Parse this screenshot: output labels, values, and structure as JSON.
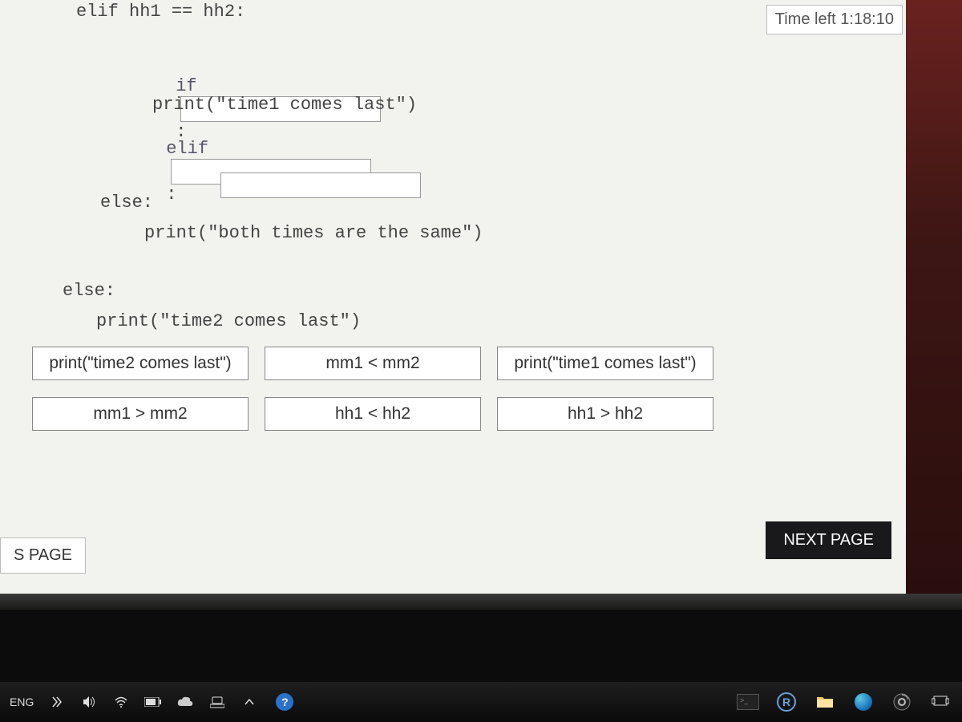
{
  "timer": {
    "label": "Time left 1:18:10"
  },
  "code": {
    "line0": "elif hh1 == hh2:",
    "if_kw": "if",
    "colon1": ":",
    "print1": "print(\"time1 comes last\")",
    "elif_kw": "elif",
    "colon2": ":",
    "inner_else": "else:",
    "print_same": "print(\"both times are the same\")",
    "outer_else": "else:",
    "print_time2": "print(\"time2 comes last\")"
  },
  "options": {
    "o1": "print(\"time2 comes last\")",
    "o2": "mm1 < mm2",
    "o3": "print(\"time1 comes last\")",
    "o4": "mm1 > mm2",
    "o5": "hh1 < hh2",
    "o6": "hh1 > hh2"
  },
  "nav": {
    "prev": "S PAGE",
    "next": "NEXT PAGE"
  },
  "taskbar": {
    "lang": "ENG",
    "help_glyph": "?",
    "r_glyph": "R"
  }
}
